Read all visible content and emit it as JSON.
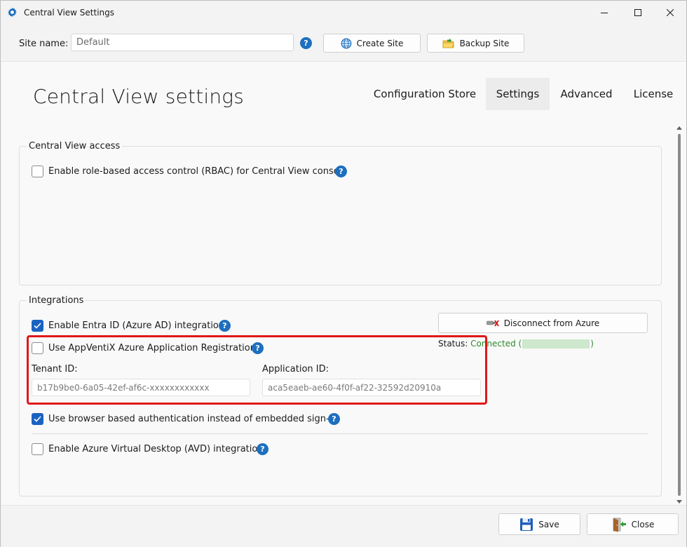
{
  "window": {
    "title": "Central View Settings",
    "icon": "gear-icon",
    "controls": [
      "minimize-icon",
      "maximize-icon",
      "close-icon"
    ]
  },
  "site": {
    "label": "Site name:",
    "value": "Default",
    "create_label": "Create Site",
    "backup_label": "Backup Site"
  },
  "page": {
    "title": "Central View settings"
  },
  "tabs": [
    {
      "label": "Configuration Store",
      "active": false
    },
    {
      "label": "Settings",
      "active": true
    },
    {
      "label": "Advanced",
      "active": false
    },
    {
      "label": "License",
      "active": false
    }
  ],
  "access": {
    "group_label": "Central View access",
    "rbac_label": "Enable role-based access control (RBAC) for Central View console",
    "rbac_checked": false
  },
  "integrations": {
    "group_label": "Integrations",
    "entra_label": "Enable Entra ID (Azure AD) integration",
    "entra_checked": true,
    "disconnect_label": "Disconnect from Azure",
    "status_label": "Status:",
    "status_value": "Connected (",
    "status_close": ")",
    "appventix_label": "Use AppVentiX Azure Application Registration",
    "appventix_checked": false,
    "tenant_label": "Tenant ID:",
    "tenant_value": "b17b9be0-6a05-42ef-af6c-xxxxxxxxxxxx",
    "app_label": "Application ID:",
    "app_value": "aca5eaeb-ae60-4f0f-af22-32592d20910a",
    "browser_label": "Use browser based authentication instead of embedded sign-in",
    "browser_checked": true,
    "avd_label": "Enable Azure Virtual Desktop (AVD) integration",
    "avd_checked": false
  },
  "footer": {
    "save_label": "Save",
    "close_label": "Close"
  },
  "colors": {
    "accent": "#1a62c2",
    "help": "#1e6fbf",
    "connected": "#2e8b2e",
    "highlight": "#e01818"
  }
}
